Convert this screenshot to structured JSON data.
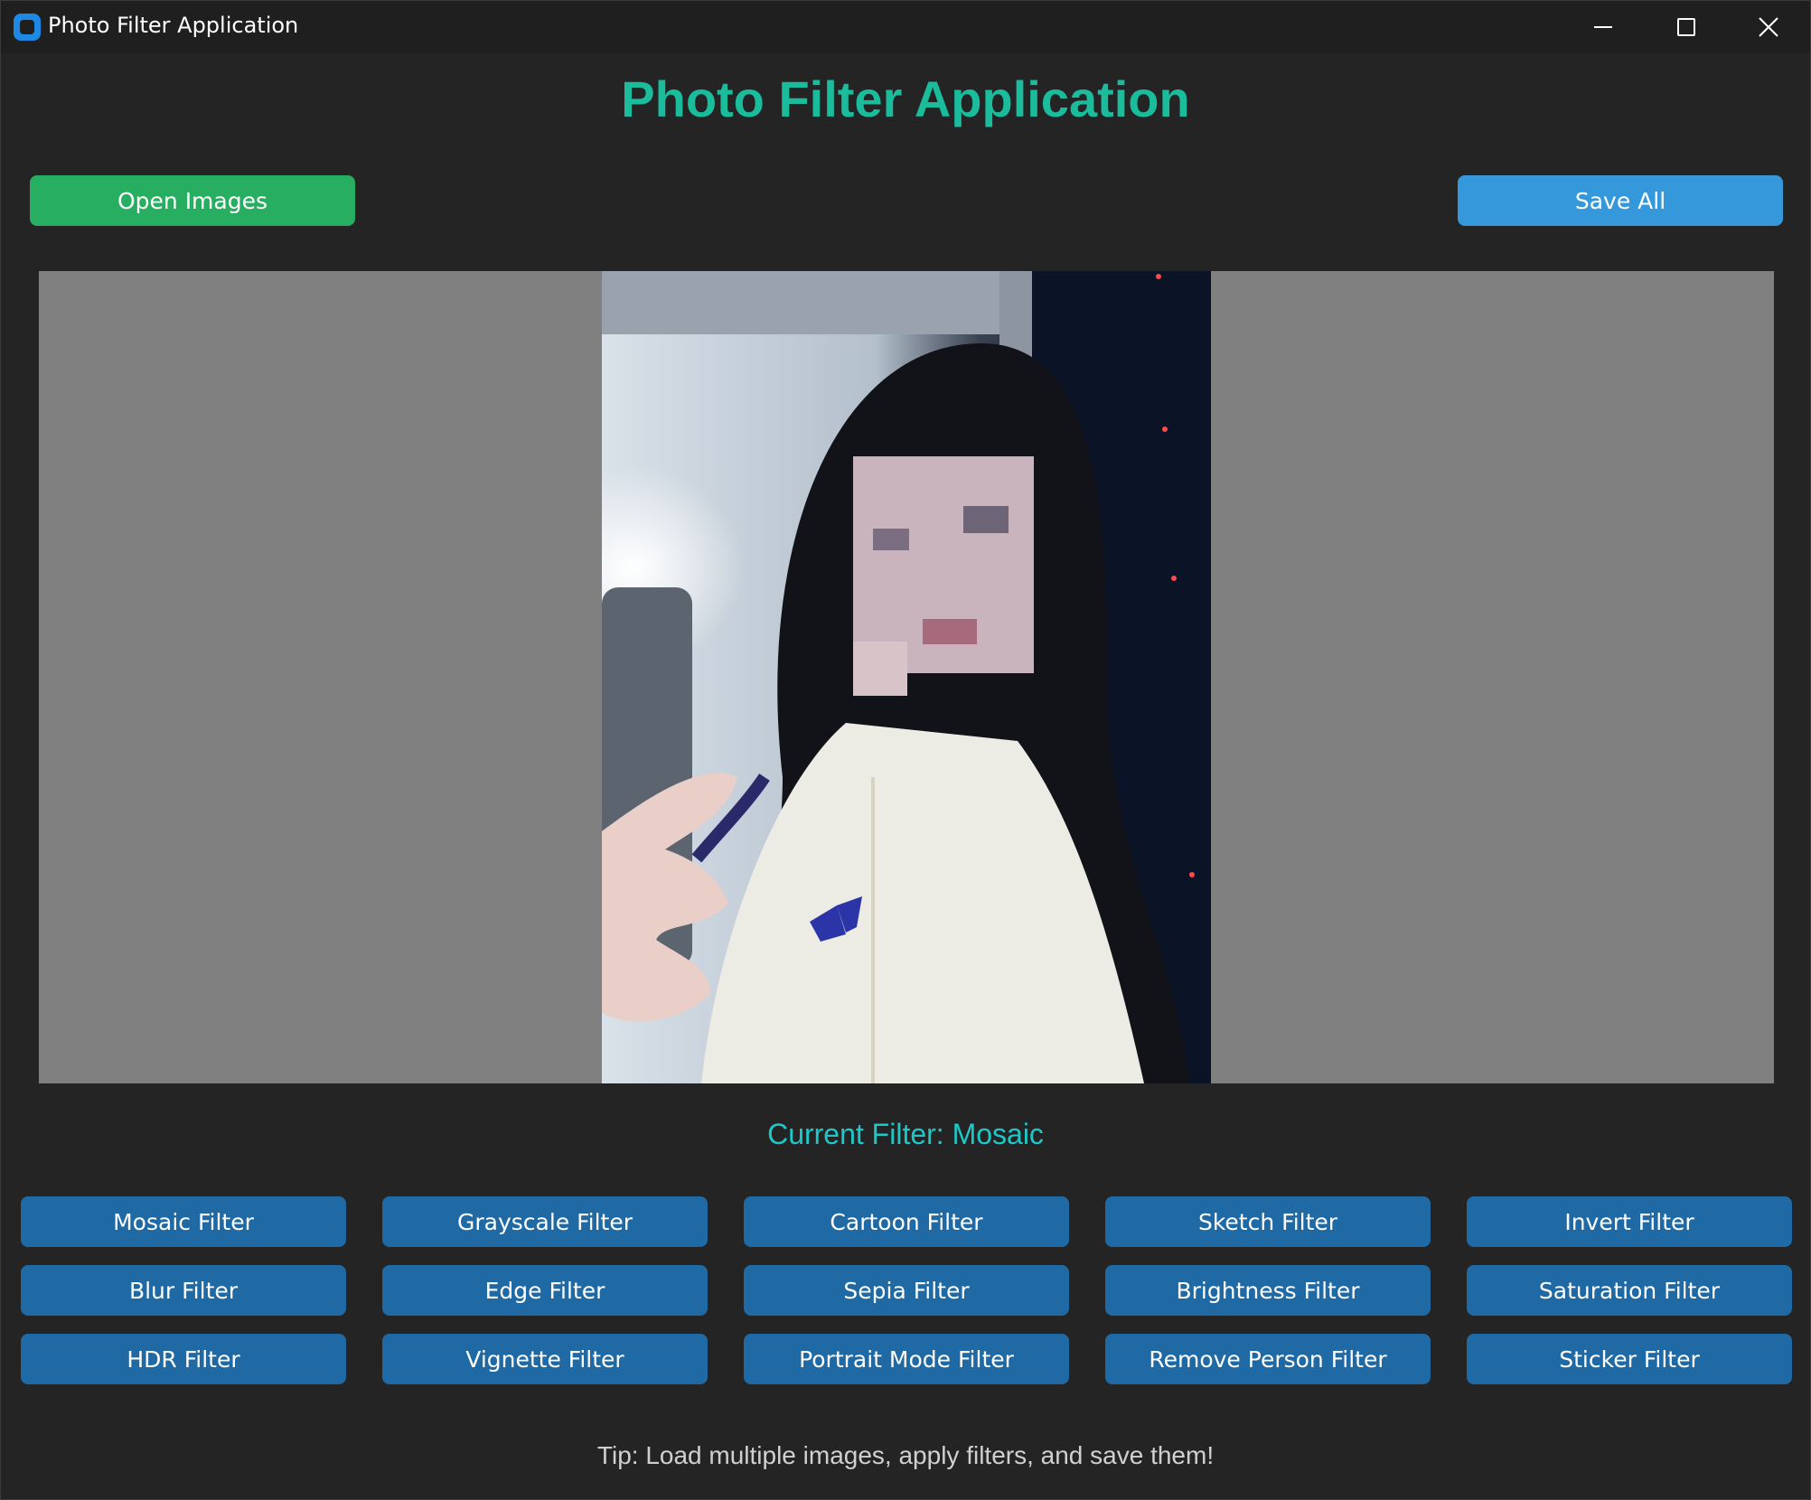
{
  "window": {
    "title": "Photo Filter Application",
    "icon": "app-icon"
  },
  "header": {
    "title": "Photo Filter Application"
  },
  "toolbar": {
    "open_label": "Open Images",
    "save_label": "Save All"
  },
  "status": {
    "current_filter": "Current Filter: Mosaic"
  },
  "filters": [
    "Mosaic Filter",
    "Grayscale Filter",
    "Cartoon Filter",
    "Sketch Filter",
    "Invert Filter",
    "Blur Filter",
    "Edge Filter",
    "Sepia Filter",
    "Brightness Filter",
    "Saturation Filter",
    "HDR Filter",
    "Vignette Filter",
    "Portrait Mode Filter",
    "Remove Person Filter",
    "Sticker Filter"
  ],
  "footer": {
    "tip": "Tip: Load multiple images, apply filters, and save them!"
  },
  "colors": {
    "accent": "#1abc9c",
    "open_button": "#27ae60",
    "save_button": "#3498db",
    "filter_button": "#1f6aa5",
    "status_text": "#1fc8c8",
    "background": "#242424"
  }
}
